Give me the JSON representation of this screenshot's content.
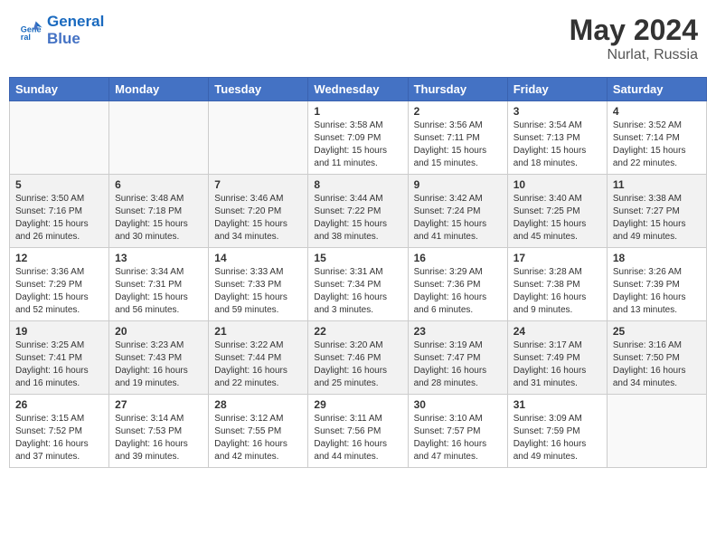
{
  "header": {
    "logo_line1": "General",
    "logo_line2": "Blue",
    "month_year": "May 2024",
    "location": "Nurlat, Russia"
  },
  "weekdays": [
    "Sunday",
    "Monday",
    "Tuesday",
    "Wednesday",
    "Thursday",
    "Friday",
    "Saturday"
  ],
  "weeks": [
    [
      {
        "day": "",
        "info": ""
      },
      {
        "day": "",
        "info": ""
      },
      {
        "day": "",
        "info": ""
      },
      {
        "day": "1",
        "info": "Sunrise: 3:58 AM\nSunset: 7:09 PM\nDaylight: 15 hours and 11 minutes."
      },
      {
        "day": "2",
        "info": "Sunrise: 3:56 AM\nSunset: 7:11 PM\nDaylight: 15 hours and 15 minutes."
      },
      {
        "day": "3",
        "info": "Sunrise: 3:54 AM\nSunset: 7:13 PM\nDaylight: 15 hours and 18 minutes."
      },
      {
        "day": "4",
        "info": "Sunrise: 3:52 AM\nSunset: 7:14 PM\nDaylight: 15 hours and 22 minutes."
      }
    ],
    [
      {
        "day": "5",
        "info": "Sunrise: 3:50 AM\nSunset: 7:16 PM\nDaylight: 15 hours and 26 minutes."
      },
      {
        "day": "6",
        "info": "Sunrise: 3:48 AM\nSunset: 7:18 PM\nDaylight: 15 hours and 30 minutes."
      },
      {
        "day": "7",
        "info": "Sunrise: 3:46 AM\nSunset: 7:20 PM\nDaylight: 15 hours and 34 minutes."
      },
      {
        "day": "8",
        "info": "Sunrise: 3:44 AM\nSunset: 7:22 PM\nDaylight: 15 hours and 38 minutes."
      },
      {
        "day": "9",
        "info": "Sunrise: 3:42 AM\nSunset: 7:24 PM\nDaylight: 15 hours and 41 minutes."
      },
      {
        "day": "10",
        "info": "Sunrise: 3:40 AM\nSunset: 7:25 PM\nDaylight: 15 hours and 45 minutes."
      },
      {
        "day": "11",
        "info": "Sunrise: 3:38 AM\nSunset: 7:27 PM\nDaylight: 15 hours and 49 minutes."
      }
    ],
    [
      {
        "day": "12",
        "info": "Sunrise: 3:36 AM\nSunset: 7:29 PM\nDaylight: 15 hours and 52 minutes."
      },
      {
        "day": "13",
        "info": "Sunrise: 3:34 AM\nSunset: 7:31 PM\nDaylight: 15 hours and 56 minutes."
      },
      {
        "day": "14",
        "info": "Sunrise: 3:33 AM\nSunset: 7:33 PM\nDaylight: 15 hours and 59 minutes."
      },
      {
        "day": "15",
        "info": "Sunrise: 3:31 AM\nSunset: 7:34 PM\nDaylight: 16 hours and 3 minutes."
      },
      {
        "day": "16",
        "info": "Sunrise: 3:29 AM\nSunset: 7:36 PM\nDaylight: 16 hours and 6 minutes."
      },
      {
        "day": "17",
        "info": "Sunrise: 3:28 AM\nSunset: 7:38 PM\nDaylight: 16 hours and 9 minutes."
      },
      {
        "day": "18",
        "info": "Sunrise: 3:26 AM\nSunset: 7:39 PM\nDaylight: 16 hours and 13 minutes."
      }
    ],
    [
      {
        "day": "19",
        "info": "Sunrise: 3:25 AM\nSunset: 7:41 PM\nDaylight: 16 hours and 16 minutes."
      },
      {
        "day": "20",
        "info": "Sunrise: 3:23 AM\nSunset: 7:43 PM\nDaylight: 16 hours and 19 minutes."
      },
      {
        "day": "21",
        "info": "Sunrise: 3:22 AM\nSunset: 7:44 PM\nDaylight: 16 hours and 22 minutes."
      },
      {
        "day": "22",
        "info": "Sunrise: 3:20 AM\nSunset: 7:46 PM\nDaylight: 16 hours and 25 minutes."
      },
      {
        "day": "23",
        "info": "Sunrise: 3:19 AM\nSunset: 7:47 PM\nDaylight: 16 hours and 28 minutes."
      },
      {
        "day": "24",
        "info": "Sunrise: 3:17 AM\nSunset: 7:49 PM\nDaylight: 16 hours and 31 minutes."
      },
      {
        "day": "25",
        "info": "Sunrise: 3:16 AM\nSunset: 7:50 PM\nDaylight: 16 hours and 34 minutes."
      }
    ],
    [
      {
        "day": "26",
        "info": "Sunrise: 3:15 AM\nSunset: 7:52 PM\nDaylight: 16 hours and 37 minutes."
      },
      {
        "day": "27",
        "info": "Sunrise: 3:14 AM\nSunset: 7:53 PM\nDaylight: 16 hours and 39 minutes."
      },
      {
        "day": "28",
        "info": "Sunrise: 3:12 AM\nSunset: 7:55 PM\nDaylight: 16 hours and 42 minutes."
      },
      {
        "day": "29",
        "info": "Sunrise: 3:11 AM\nSunset: 7:56 PM\nDaylight: 16 hours and 44 minutes."
      },
      {
        "day": "30",
        "info": "Sunrise: 3:10 AM\nSunset: 7:57 PM\nDaylight: 16 hours and 47 minutes."
      },
      {
        "day": "31",
        "info": "Sunrise: 3:09 AM\nSunset: 7:59 PM\nDaylight: 16 hours and 49 minutes."
      },
      {
        "day": "",
        "info": ""
      }
    ]
  ]
}
